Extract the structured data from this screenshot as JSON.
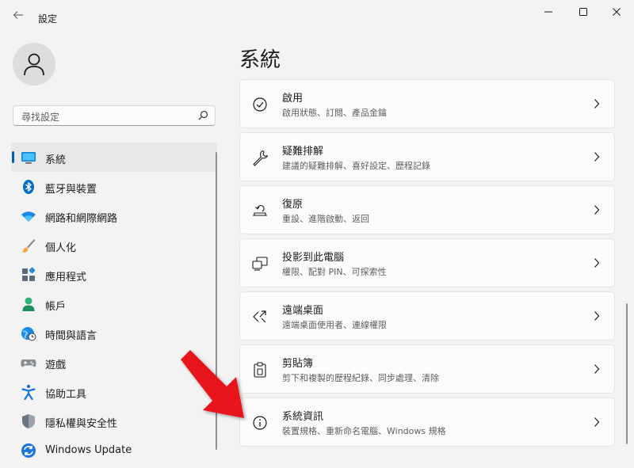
{
  "window": {
    "title": "設定",
    "back_icon": "back-arrow-icon",
    "controls": [
      "minimize-icon",
      "maximize-icon",
      "close-icon"
    ]
  },
  "user": {
    "avatar_icon": "person-icon"
  },
  "search": {
    "placeholder": "尋找設定",
    "icon": "search-icon"
  },
  "sidebar": {
    "items": [
      {
        "label": "系統",
        "icon": "display-icon",
        "selected": true
      },
      {
        "label": "藍牙與裝置",
        "icon": "bluetooth-icon"
      },
      {
        "label": "網路和網際網路",
        "icon": "wifi-icon"
      },
      {
        "label": "個人化",
        "icon": "brush-icon"
      },
      {
        "label": "應用程式",
        "icon": "apps-icon"
      },
      {
        "label": "帳戶",
        "icon": "account-icon"
      },
      {
        "label": "時間與語言",
        "icon": "globe-clock-icon"
      },
      {
        "label": "遊戲",
        "icon": "gamepad-icon"
      },
      {
        "label": "協助工具",
        "icon": "accessibility-icon"
      },
      {
        "label": "隱私權與安全性",
        "icon": "shield-icon"
      },
      {
        "label": "Windows Update",
        "icon": "update-icon"
      }
    ]
  },
  "main": {
    "title": "系統",
    "cards": [
      {
        "title": "啟用",
        "desc": "啟用狀態、訂閱、產品金鑰",
        "icon": "activation-check-icon"
      },
      {
        "title": "疑難排解",
        "desc": "建議的疑難排解、喜好設定、歷程記錄",
        "icon": "wrench-icon"
      },
      {
        "title": "復原",
        "desc": "重設、進階啟動、返回",
        "icon": "recovery-icon"
      },
      {
        "title": "投影到此電腦",
        "desc": "權限、配對 PIN、可探索性",
        "icon": "projection-icon"
      },
      {
        "title": "遠端桌面",
        "desc": "遠端桌面使用者、連線權限",
        "icon": "remote-desktop-icon"
      },
      {
        "title": "剪貼簿",
        "desc": "剪下和複製的歷程紀錄、同步處理、清除",
        "icon": "clipboard-icon"
      },
      {
        "title": "系統資訊",
        "desc": "裝置規格、重新命名電腦、Windows 規格",
        "icon": "info-icon"
      }
    ]
  },
  "colors": {
    "accent": "#005fb8",
    "background": "#f3f3f3",
    "card": "#fbfbfb",
    "annotation_arrow": "#e8141b"
  }
}
